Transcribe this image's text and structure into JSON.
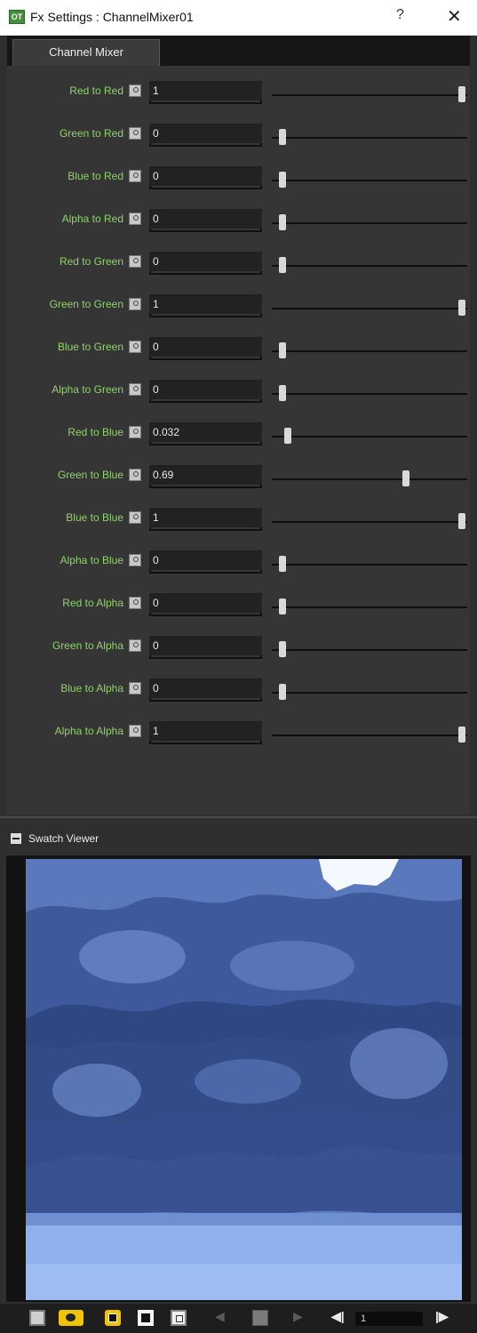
{
  "window": {
    "icon_text": "OT",
    "title": "Fx Settings : ChannelMixer01",
    "help_label": "?",
    "close_label": "✕"
  },
  "tabs": [
    {
      "label": "Channel Mixer",
      "active": true
    }
  ],
  "params": [
    {
      "label": "Red to Red",
      "value": "1",
      "fraction": 1.0
    },
    {
      "label": "Green to Red",
      "value": "0",
      "fraction": 0.0
    },
    {
      "label": "Blue to Red",
      "value": "0",
      "fraction": 0.0
    },
    {
      "label": "Alpha to Red",
      "value": "0",
      "fraction": 0.0
    },
    {
      "label": "Red to Green",
      "value": "0",
      "fraction": 0.0
    },
    {
      "label": "Green to Green",
      "value": "1",
      "fraction": 1.0
    },
    {
      "label": "Blue to Green",
      "value": "0",
      "fraction": 0.0
    },
    {
      "label": "Alpha to Green",
      "value": "0",
      "fraction": 0.0
    },
    {
      "label": "Red to Blue",
      "value": "0.032",
      "fraction": 0.032
    },
    {
      "label": "Green to Blue",
      "value": "0.69",
      "fraction": 0.69
    },
    {
      "label": "Blue to Blue",
      "value": "1",
      "fraction": 1.0
    },
    {
      "label": "Alpha to Blue",
      "value": "0",
      "fraction": 0.0
    },
    {
      "label": "Red to Alpha",
      "value": "0",
      "fraction": 0.0
    },
    {
      "label": "Green to Alpha",
      "value": "0",
      "fraction": 0.0
    },
    {
      "label": "Blue to Alpha",
      "value": "0",
      "fraction": 0.0
    },
    {
      "label": "Alpha to Alpha",
      "value": "1",
      "fraction": 1.0
    }
  ],
  "swatch": {
    "title": "Swatch Viewer",
    "collapse_label": "−"
  },
  "toolbar": {
    "prev_label": "◀",
    "next_label": "▶",
    "first_label": "◀|",
    "last_label": "|▶",
    "frame_value": "1"
  },
  "colors": {
    "label_green": "#8fd26b",
    "accent_yellow": "#f0c400",
    "panel_bg": "#353535"
  }
}
